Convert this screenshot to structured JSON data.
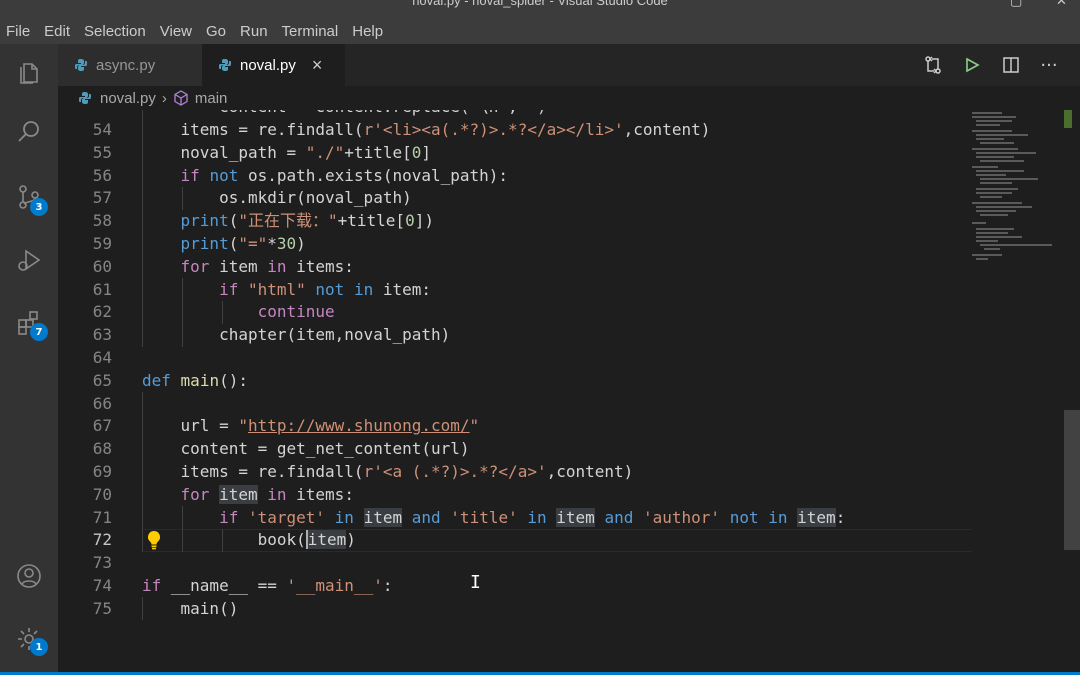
{
  "window": {
    "title": "noval.py - noval_spider - Visual Studio Code"
  },
  "menu": [
    "File",
    "Edit",
    "Selection",
    "View",
    "Go",
    "Run",
    "Terminal",
    "Help"
  ],
  "activity": {
    "scm_badge": "3",
    "extensions_badge": "7",
    "settings_badge": "1"
  },
  "tabs": [
    {
      "label": "async.py",
      "active": false
    },
    {
      "label": "noval.py",
      "active": true,
      "close": "×"
    }
  ],
  "breadcrumb": {
    "file": "noval.py",
    "symbol": "main",
    "separator": "›"
  },
  "editor": {
    "language": "python",
    "current_line": 72,
    "line_numbers": [
      "54",
      "55",
      "56",
      "57",
      "58",
      "59",
      "60",
      "61",
      "62",
      "63",
      "64",
      "65",
      "66",
      "67",
      "68",
      "69",
      "70",
      "71",
      "72",
      "73",
      "74",
      "75"
    ],
    "partial_top_line": "        content = content.replace(\"\\n\",\"\")",
    "lines": {
      "l54": {
        "a": "    items = re.findall(",
        "b": "r'<li><a(.*?)>.*?</a></li>'",
        "c": ",content)"
      },
      "l55": {
        "a": "    noval_path = ",
        "b": "\"./\"",
        "c": "+title[",
        "d": "0",
        "e": "]"
      },
      "l56": {
        "a": "    ",
        "b": "if",
        "c": " ",
        "d": "not",
        "e": " os.path.exists(noval_path):"
      },
      "l57": {
        "a": "        os.mkdir(noval_path)"
      },
      "l58": {
        "a": "    ",
        "b": "print",
        "c": "(",
        "d": "\"正在下载：\"",
        "e": "+title[",
        "f": "0",
        "g": "])"
      },
      "l59": {
        "a": "    ",
        "b": "print",
        "c": "(",
        "d": "\"=\"",
        "e": "*",
        "f": "30",
        "g": ")"
      },
      "l60": {
        "a": "    ",
        "b": "for",
        "c": " item ",
        "d": "in",
        "e": " items:"
      },
      "l61": {
        "a": "        ",
        "b": "if",
        "c": " ",
        "d": "\"html\"",
        "e": " ",
        "f": "not",
        "g": " ",
        "h": "in",
        "i": " item:"
      },
      "l62": {
        "a": "            ",
        "b": "continue"
      },
      "l63": {
        "a": "        chapter(item,noval_path)"
      },
      "l65": {
        "a": "def",
        "b": " ",
        "c": "main",
        "d": "():"
      },
      "l67": {
        "a": "    url = ",
        "b": "\"",
        "c": "http://www.shunong.com/",
        "d": "\""
      },
      "l68": {
        "a": "    content = get_net_content(url)"
      },
      "l69": {
        "a": "    items = re.findall(",
        "b": "r'<a (.*?)>.*?</a>'",
        "c": ",content)"
      },
      "l70": {
        "a": "    ",
        "b": "for",
        "c": " ",
        "d": "item",
        "e": " ",
        "f": "in",
        "g": " items:"
      },
      "l71": {
        "a": "        ",
        "b": "if",
        "c": " ",
        "d": "'target'",
        "e": " ",
        "f": "in",
        "g": " ",
        "h": "item",
        "i": " ",
        "j": "and",
        "k": " ",
        "l": "'title'",
        "m": " ",
        "n": "in",
        "o": " ",
        "p": "item",
        "q": " ",
        "r": "and",
        "s": " ",
        "t": "'author'",
        "u": " ",
        "v": "not",
        "w": " ",
        "x": "in",
        "y": " ",
        "z": "item",
        "zz": ":"
      },
      "l72": {
        "a": "            book(",
        "b": "item",
        "c": ")"
      },
      "l74": {
        "a": "if",
        "b": " __name__ == ",
        "c": "'__main__'",
        "d": ":"
      },
      "l75": {
        "a": "    main()"
      }
    }
  },
  "colors": {
    "background": "#1e1e1e",
    "keyword": "#569cd6",
    "control": "#c586c0",
    "string": "#ce9178",
    "number": "#b5cea8",
    "accent": "#007acc"
  }
}
